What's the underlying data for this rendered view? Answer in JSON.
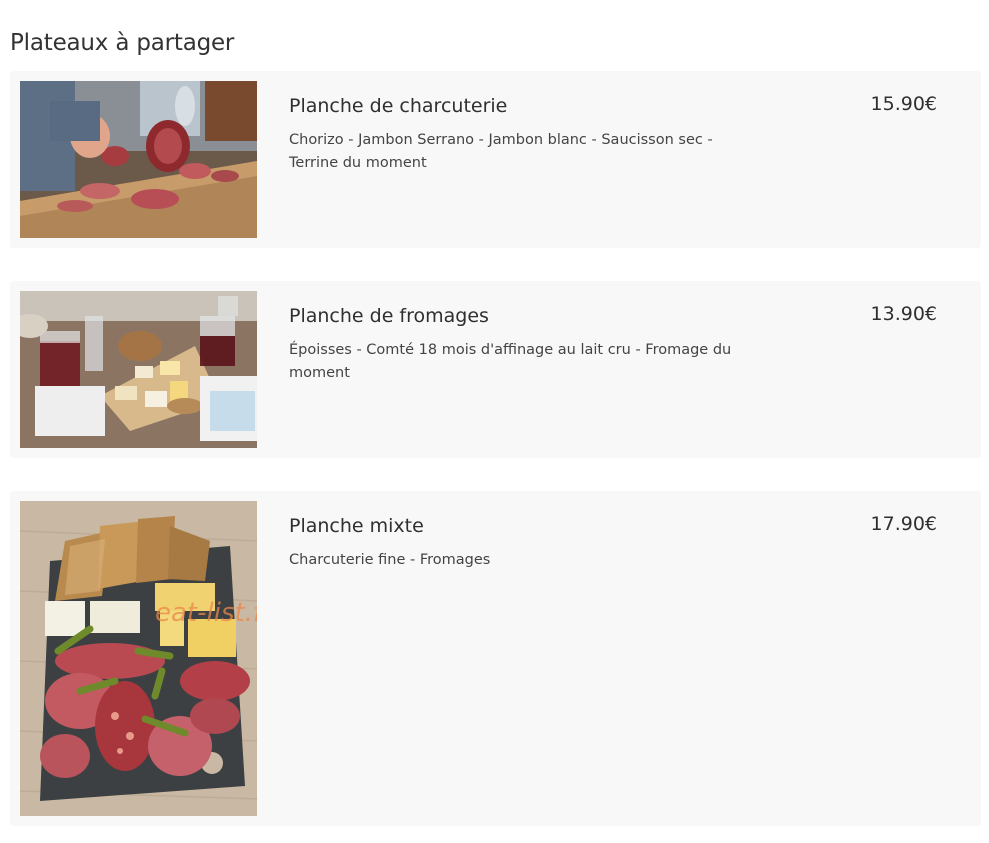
{
  "section": {
    "title": "Plateaux à partager"
  },
  "items": [
    {
      "name": "Planche de charcuterie",
      "description": "Chorizo - Jambon Serrano - Jambon blanc - Saucisson sec - Terrine du moment",
      "price": "15.90€",
      "image_icon": "charcuterie-board-photo"
    },
    {
      "name": "Planche de fromages",
      "description": "Époisses - Comté 18 mois d'affinage au lait cru - Fromage du moment",
      "price": "13.90€",
      "image_icon": "cheese-board-photo"
    },
    {
      "name": "Planche mixte",
      "description": "Charcuterie fine - Fromages",
      "price": "17.90€",
      "image_icon": "mixed-board-photo",
      "watermark": "eat-list.fr"
    }
  ],
  "colors": {
    "card_background": "#f8f8f8",
    "text": "#333333",
    "watermark": "#e9894a"
  }
}
